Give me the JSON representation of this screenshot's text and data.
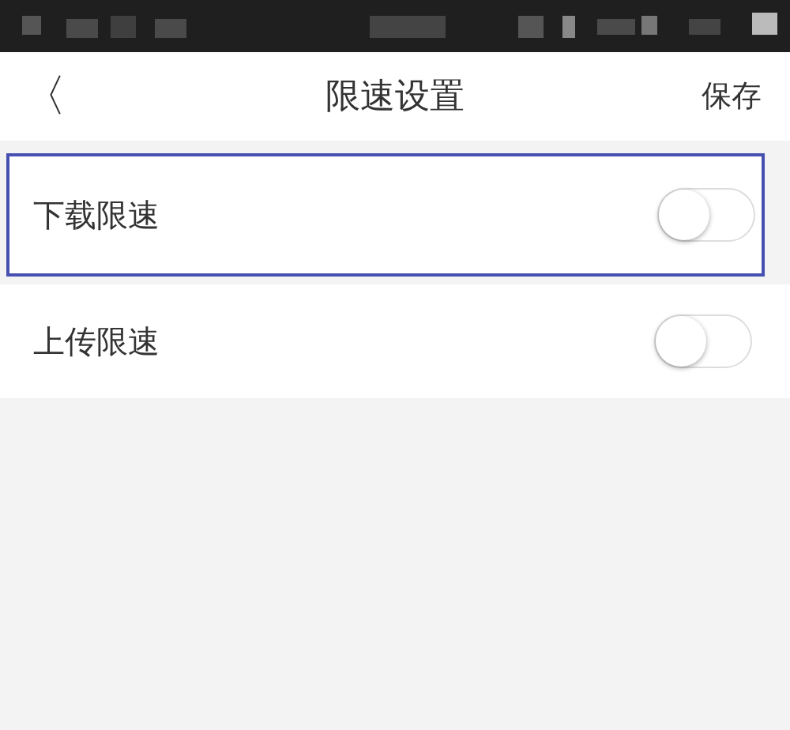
{
  "header": {
    "back": "〈",
    "title": "限速设置",
    "action": "保存"
  },
  "settings": [
    {
      "label": "下载限速",
      "on": false,
      "highlighted": true
    },
    {
      "label": "上传限速",
      "on": false,
      "highlighted": false
    }
  ]
}
